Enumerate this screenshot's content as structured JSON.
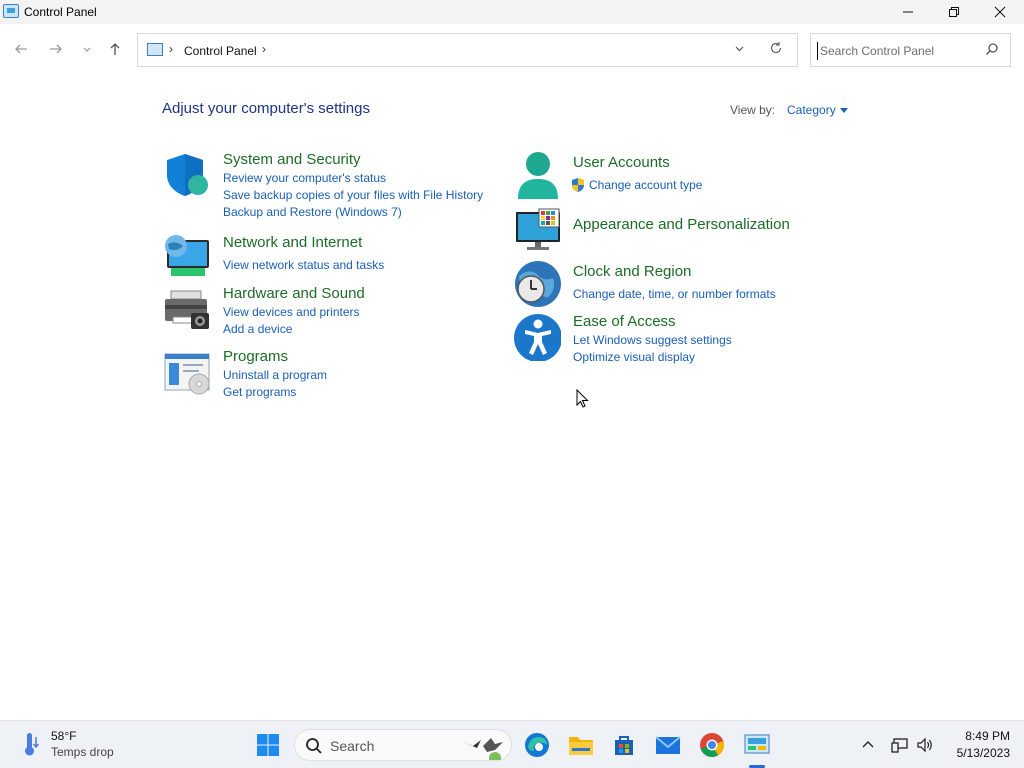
{
  "window": {
    "title": "Control Panel"
  },
  "address": {
    "crumb": "Control Panel"
  },
  "search": {
    "placeholder": "Search Control Panel"
  },
  "main": {
    "heading": "Adjust your computer's settings",
    "view_by_label": "View by:",
    "view_by_value": "Category"
  },
  "categories": [
    {
      "title": "System and Security",
      "links": [
        "Review your computer's status",
        "Save backup copies of your files with File History",
        "Backup and Restore (Windows 7)"
      ]
    },
    {
      "title": "Network and Internet",
      "links": [
        "View network status and tasks"
      ]
    },
    {
      "title": "Hardware and Sound",
      "links": [
        "View devices and printers",
        "Add a device"
      ]
    },
    {
      "title": "Programs",
      "links": [
        "Uninstall a program",
        "Get programs"
      ]
    },
    {
      "title": "User Accounts",
      "links": [
        "Change account type"
      ]
    },
    {
      "title": "Appearance and Personalization",
      "links": []
    },
    {
      "title": "Clock and Region",
      "links": [
        "Change date, time, or number formats"
      ]
    },
    {
      "title": "Ease of Access",
      "links": [
        "Let Windows suggest settings",
        "Optimize visual display"
      ]
    }
  ],
  "taskbar": {
    "weather_temp": "58°F",
    "weather_desc": "Temps drop",
    "search_label": "Search",
    "time": "8:49 PM",
    "date": "5/13/2023",
    "apps": [
      "start",
      "search",
      "edge",
      "file-explorer",
      "store",
      "mail",
      "chrome",
      "control-panel"
    ]
  },
  "colors": {
    "category_title": "#1d6b28",
    "link": "#1a5fb4",
    "heading": "#1e3287",
    "accent": "#2a6ad8"
  }
}
